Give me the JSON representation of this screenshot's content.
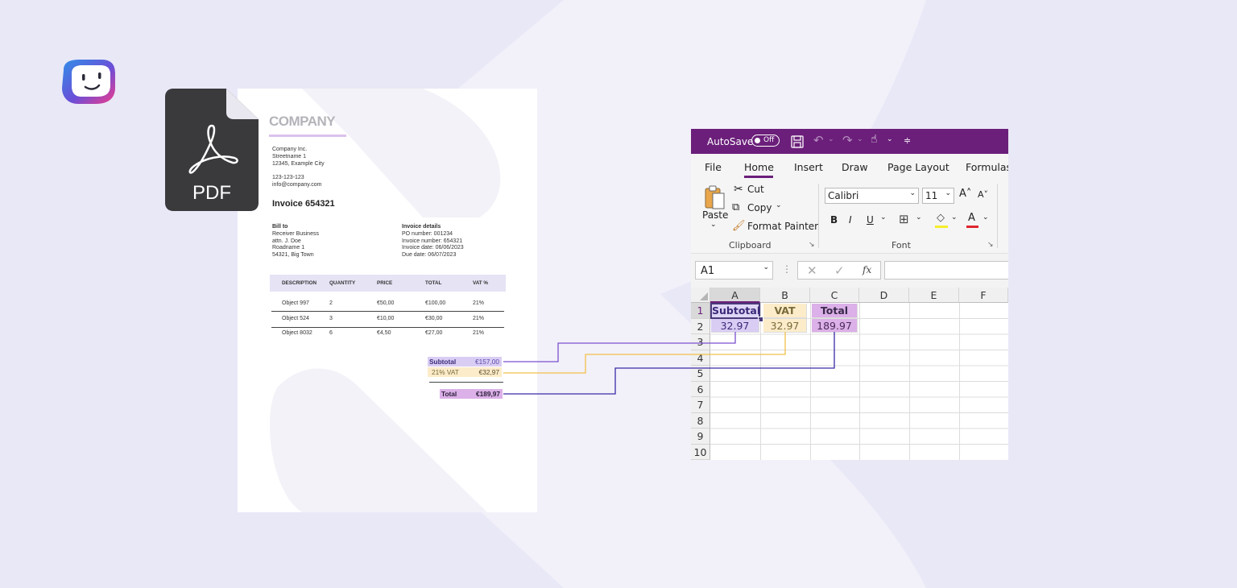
{
  "colors": {
    "background": "#e9e8f7",
    "subtotal": "#7b4fd0",
    "vat": "#f2c04a",
    "total": "#3a2aa8",
    "excel_titlebar": "#6b1f7a"
  },
  "logo": {
    "icon": "smiley-face-icon"
  },
  "pdf_icon": {
    "label": "PDF",
    "icon": "acrobat-icon"
  },
  "invoice": {
    "company_logo_text": "COMPANY",
    "company_address": [
      "Company Inc.",
      "Streetname 1",
      "12345, Example City"
    ],
    "company_contact": [
      "123-123-123",
      "info@company.com"
    ],
    "title": "Invoice 654321",
    "bill_to": {
      "heading": "Bill to",
      "lines": [
        "Receiver Business",
        "attn. J. Doe",
        "Roadname 1",
        "54321, Big Town"
      ]
    },
    "details": {
      "heading": "Invoice details",
      "lines": [
        "PO number: 001234",
        "Invoice number: 654321",
        "Invoice date: 06/06/2023",
        "Due date: 06/07/2023"
      ]
    },
    "table": {
      "headers": [
        "DESCRIPTION",
        "QUANTITY",
        "PRICE",
        "TOTAL",
        "VAT %"
      ],
      "rows": [
        [
          "Object 997",
          "2",
          "€50,00",
          "€100,00",
          "21%"
        ],
        [
          "Object 524",
          "3",
          "€10,00",
          "€30,00",
          "21%"
        ],
        [
          "Object 8032",
          "6",
          "€4,50",
          "€27,00",
          "21%"
        ]
      ]
    },
    "summary": {
      "subtotal_label": "Subtotal",
      "subtotal_value": "€157,00",
      "vat_label": "21% VAT",
      "vat_value": "€32,97",
      "total_label": "Total",
      "total_value": "€189,97"
    }
  },
  "excel": {
    "titlebar": {
      "autosave_label": "AutoSave",
      "autosave_state": "Off"
    },
    "tabs": [
      "File",
      "Home",
      "Insert",
      "Draw",
      "Page Layout",
      "Formulas"
    ],
    "active_tab": "Home",
    "clipboard": {
      "paste": "Paste",
      "cut": "Cut",
      "copy": "Copy",
      "format_painter": "Format Painter",
      "group_label": "Clipboard"
    },
    "font": {
      "name": "Calibri",
      "size": "11",
      "group_label": "Font",
      "bold": "B",
      "italic": "I",
      "underline": "U"
    },
    "name_box": "A1",
    "fx": "fx",
    "columns": [
      "A",
      "B",
      "C",
      "D",
      "E",
      "F"
    ],
    "rows": [
      "1",
      "2",
      "3",
      "4",
      "5",
      "6",
      "7",
      "8",
      "9",
      "10"
    ],
    "cells": {
      "A1": "Subtotal",
      "B1": "VAT",
      "C1": "Total",
      "A2": "32.97",
      "B2": "32.97",
      "C2": "189.97"
    }
  }
}
